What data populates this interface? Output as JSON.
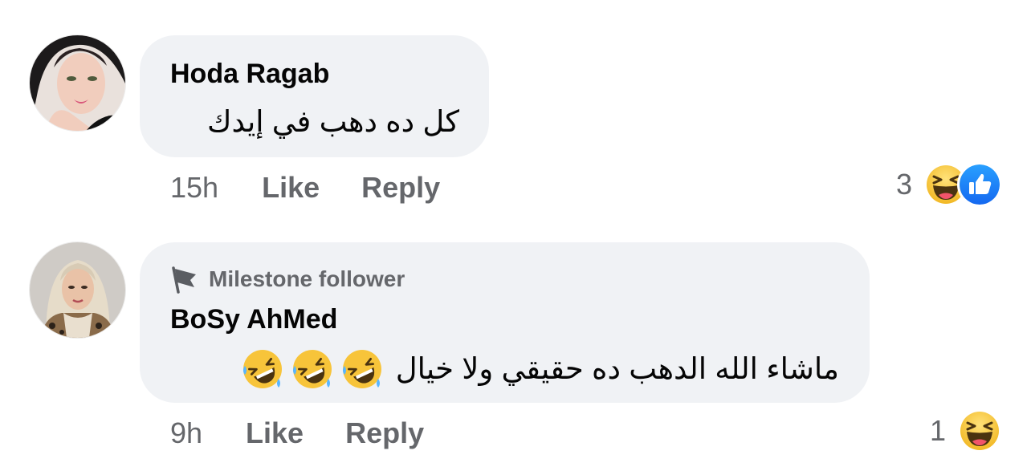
{
  "comments": [
    {
      "author": "Hoda Ragab",
      "text": "كل ده دهب في إيدك",
      "time": "15h",
      "like_label": "Like",
      "reply_label": "Reply",
      "reaction_count": "3",
      "reactions": [
        "haha-icon",
        "like-icon"
      ]
    },
    {
      "badge": "Milestone follower",
      "badge_icon": "flag-icon",
      "author": "BoSy AhMed",
      "text": "ماشاء الله الدهب ده حقيقي ولا خيال",
      "emoji": [
        "rofl-emoji",
        "rofl-emoji",
        "rofl-emoji"
      ],
      "time": "9h",
      "like_label": "Like",
      "reply_label": "Reply",
      "reaction_count": "1",
      "reactions": [
        "haha-icon"
      ]
    }
  ],
  "colors": {
    "bubble": "#f0f2f5",
    "meta_text": "#65676b",
    "like_blue": "#1877f2",
    "haha_yellow": "#f7c43a"
  }
}
